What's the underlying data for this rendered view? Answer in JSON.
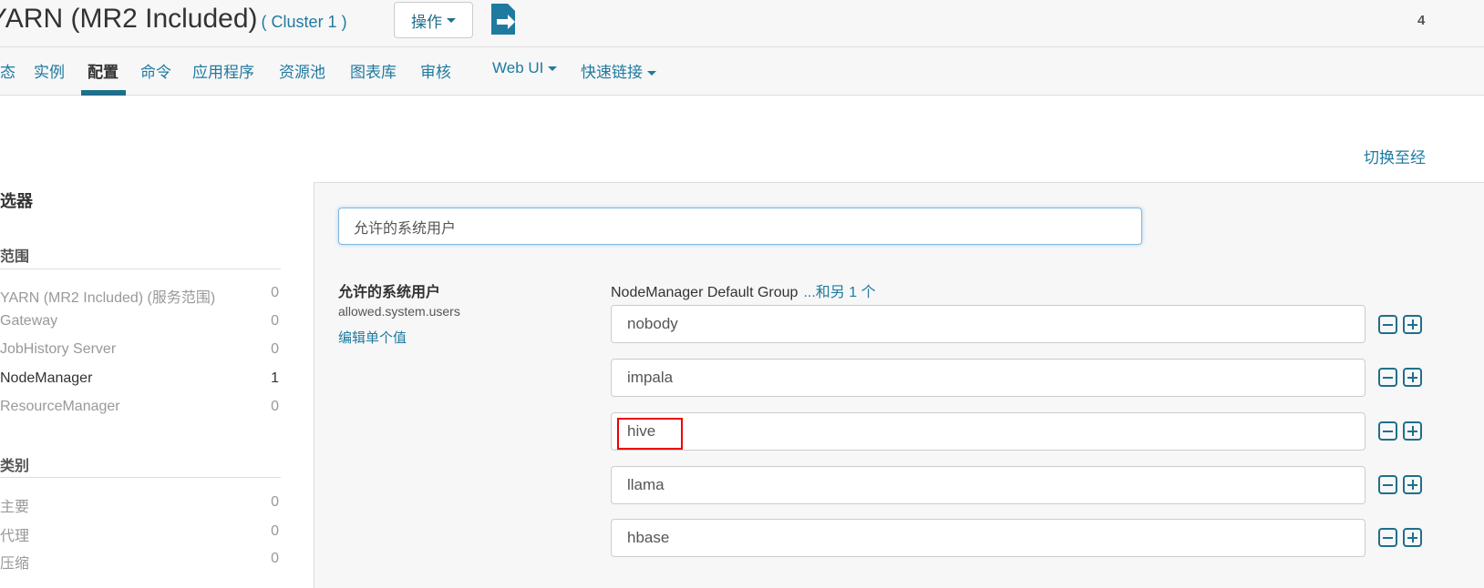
{
  "header": {
    "title": "YARN (MR2 Included)",
    "cluster": "( Cluster 1 )",
    "actions_label": "操作",
    "date_fragment": "4"
  },
  "nav": {
    "items": [
      "态",
      "实例",
      "配置",
      "命令",
      "应用程序",
      "资源池",
      "图表库",
      "审核"
    ],
    "active": "配置",
    "web_ui": "Web UI",
    "quick_links": "快速链接"
  },
  "switch_link": "切换至经",
  "sidebar": {
    "title": "选器",
    "scope": {
      "heading": "范围",
      "items": [
        {
          "label": "YARN (MR2 Included) (服务范围)",
          "count": "0"
        },
        {
          "label": "Gateway",
          "count": "0"
        },
        {
          "label": "JobHistory Server",
          "count": "0"
        },
        {
          "label": "NodeManager",
          "count": "1"
        },
        {
          "label": "ResourceManager",
          "count": "0"
        }
      ]
    },
    "category": {
      "heading": "类别",
      "items": [
        {
          "label": "主要",
          "count": "0"
        },
        {
          "label": "代理",
          "count": "0"
        },
        {
          "label": "压缩",
          "count": "0"
        }
      ]
    }
  },
  "search": {
    "value": "允许的系统用户"
  },
  "property": {
    "label": "允许的系统用户",
    "key": "allowed.system.users",
    "edit_link": "编辑单个值",
    "group": "NodeManager Default Group",
    "more": "...和另 1 个",
    "values": [
      "nobody",
      "impala",
      "hive",
      "llama",
      "hbase"
    ],
    "highlighted": "hive"
  },
  "colors": {
    "accent": "#1f6f8b",
    "link": "#1f7aa0",
    "highlight": "#e00000"
  }
}
